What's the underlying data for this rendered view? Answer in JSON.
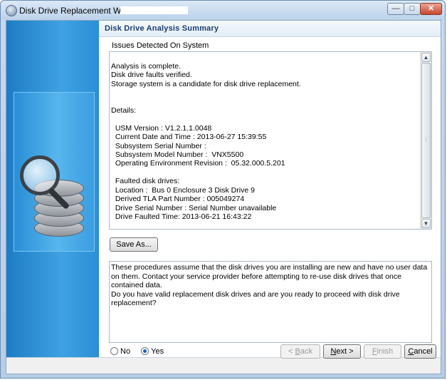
{
  "window": {
    "title": "Disk Drive Replacement Wizard -"
  },
  "header": {
    "title": "Disk Drive Analysis Summary"
  },
  "report": {
    "section_label": "Issues Detected On System",
    "lines": [
      "Analysis is complete.",
      "Disk drive faults verified.",
      "Storage system is a candidate for disk drive replacement.",
      "",
      "",
      "Details:",
      "",
      "  USM Version : V1.2.1.1.0048",
      "  Current Date and Time : 2013-06-27 15:39:55",
      "  Subsystem Serial Number :",
      "  Subsystem Model Number :  VNX5500",
      "  Operating Environment Revision :  05.32.000.5.201",
      "",
      "  Faulted disk drives:",
      "  Location :  Bus 0 Enclosure 3 Disk Drive 9",
      "  Derived TLA Part Number : 005049274",
      "  Drive Serial Number : Serial Number unavailable",
      "  Drive Faulted Time: 2013-06-21 16:43:22"
    ]
  },
  "actions": {
    "save_as_label": "Save As..."
  },
  "warning": {
    "text": "These procedures assume that the disk drives you are installing are new and have no user data on them. Contact your service provider before attempting to re-use disk drives that once contained data.",
    "question": "Do you have valid replacement disk drives and are you ready to proceed with disk drive replacement?"
  },
  "confirm": {
    "options": [
      {
        "label": "No",
        "selected": false
      },
      {
        "label": "Yes",
        "selected": true
      }
    ]
  },
  "footer": {
    "back_prefix": "< ",
    "back_key": "B",
    "back_rest": "ack",
    "next_key": "N",
    "next_rest": "ext >",
    "finish_key": "F",
    "finish_rest": "inish",
    "cancel_key": "C",
    "cancel_rest": "ancel"
  }
}
